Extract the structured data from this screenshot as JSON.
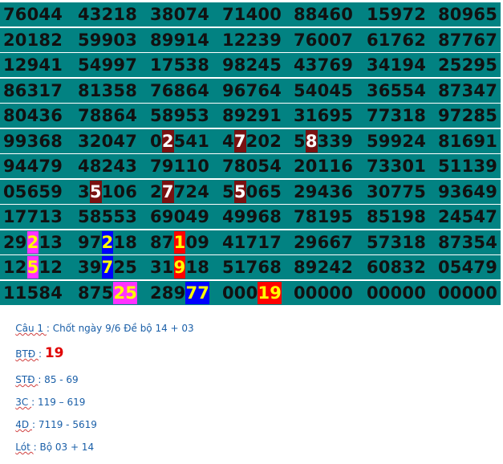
{
  "grid": {
    "rows": [
      [
        "76044",
        "43218",
        "38074",
        "71400",
        "88460",
        "15972",
        "80965"
      ],
      [
        "20182",
        "59903",
        "89914",
        "12239",
        "76007",
        "61762",
        "87767"
      ],
      [
        "12941",
        "54997",
        "17538",
        "98245",
        "43769",
        "34194",
        "25295"
      ],
      [
        "86317",
        "81358",
        "76864",
        "96764",
        "54045",
        "36554",
        "87347"
      ],
      [
        "80436",
        "78864",
        "58953",
        "89291",
        "31695",
        "77318",
        "97285"
      ],
      [
        "99368",
        "32047",
        "02541",
        "47202",
        "58339",
        "59924",
        "81691"
      ],
      [
        "94479",
        "48243",
        "79110",
        "78054",
        "20116",
        "73301",
        "51139"
      ],
      [
        "05659",
        "35106",
        "27724",
        "55065",
        "29436",
        "30775",
        "93649"
      ],
      [
        "17713",
        "58553",
        "69049",
        "49968",
        "78195",
        "85198",
        "24547"
      ],
      [
        "29213",
        "97218",
        "87109",
        "41717",
        "29667",
        "57318",
        "87354"
      ],
      [
        "12512",
        "39725",
        "31918",
        "51768",
        "89242",
        "60832",
        "05479"
      ],
      [
        "11584",
        "87525",
        "28977",
        "00019",
        "00000",
        "00000",
        "00000"
      ]
    ],
    "highlights": [
      {
        "row": 5,
        "col": 2,
        "start": 1,
        "len": 1,
        "color": "maroon"
      },
      {
        "row": 5,
        "col": 3,
        "start": 1,
        "len": 1,
        "color": "maroon"
      },
      {
        "row": 5,
        "col": 4,
        "start": 1,
        "len": 1,
        "color": "maroon"
      },
      {
        "row": 7,
        "col": 1,
        "start": 1,
        "len": 1,
        "color": "maroon"
      },
      {
        "row": 7,
        "col": 2,
        "start": 1,
        "len": 1,
        "color": "maroon"
      },
      {
        "row": 7,
        "col": 3,
        "start": 1,
        "len": 1,
        "color": "maroon"
      },
      {
        "row": 9,
        "col": 0,
        "start": 2,
        "len": 1,
        "color": "magenta"
      },
      {
        "row": 9,
        "col": 1,
        "start": 2,
        "len": 1,
        "color": "blue"
      },
      {
        "row": 9,
        "col": 2,
        "start": 2,
        "len": 1,
        "color": "red"
      },
      {
        "row": 10,
        "col": 0,
        "start": 2,
        "len": 1,
        "color": "magenta"
      },
      {
        "row": 10,
        "col": 1,
        "start": 2,
        "len": 1,
        "color": "blue"
      },
      {
        "row": 10,
        "col": 2,
        "start": 2,
        "len": 1,
        "color": "red"
      },
      {
        "row": 11,
        "col": 1,
        "start": 3,
        "len": 2,
        "color": "magenta"
      },
      {
        "row": 11,
        "col": 2,
        "start": 3,
        "len": 2,
        "color": "blue"
      },
      {
        "row": 11,
        "col": 3,
        "start": 3,
        "len": 2,
        "color": "red"
      }
    ]
  },
  "notes": {
    "cau1_label": "Câu 1 ",
    "cau1_text": ": Chốt ngày 9/6 Đề bộ 14 + 03",
    "btd_label": "BTĐ ",
    "btd_sep": ": ",
    "btd_value": "19",
    "std_label": "STĐ ",
    "std_text": ": 85 - 69",
    "c3_label": "3C ",
    "c3_text": ": 119 – 619",
    "d4_label": "4D ",
    "d4_text": ": 7119 - 5619",
    "lot_label": "Lót ",
    "lot_text": ": Bộ 03 + 14"
  },
  "colors": {
    "row_bg": "#028282",
    "digit": "#111111",
    "note_text": "#1a5fa8",
    "highlight_maroon": "#7a1111",
    "highlight_magenta": "#ff33ff",
    "highlight_blue": "#0000ff",
    "highlight_red": "#ff0000"
  }
}
